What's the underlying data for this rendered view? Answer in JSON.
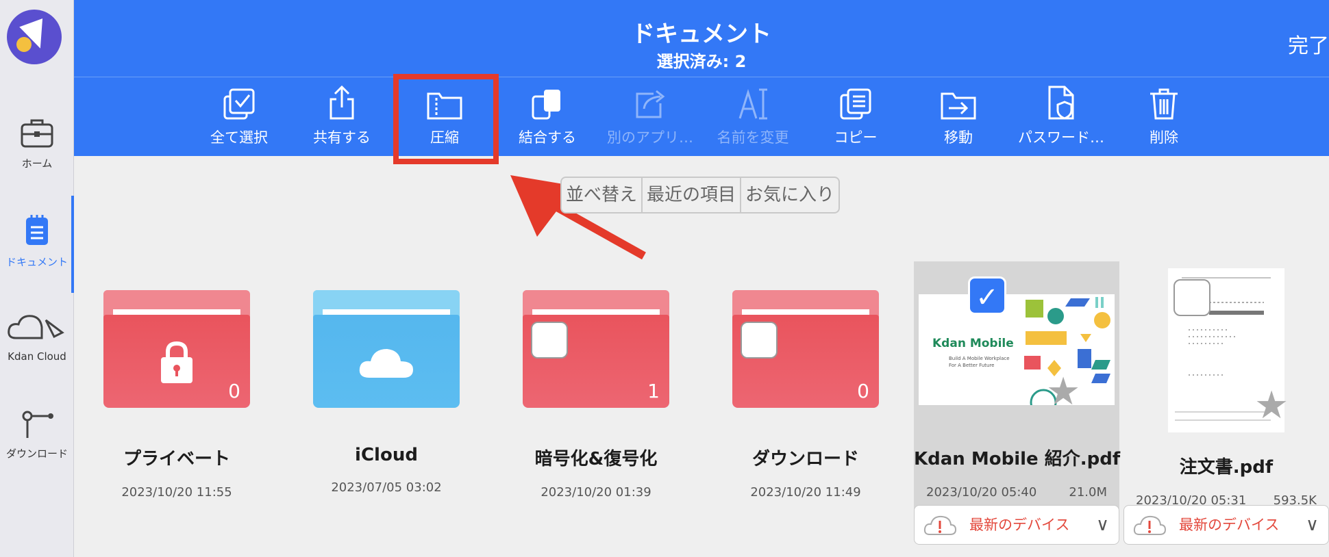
{
  "sidebar": {
    "items": [
      {
        "label": "ホーム",
        "icon": "briefcase-icon"
      },
      {
        "label": "ドキュメント",
        "icon": "document-icon"
      },
      {
        "label": "Kdan Cloud",
        "icon": "cloud-icon"
      },
      {
        "label": "ダウンロード",
        "icon": "download-icon"
      }
    ],
    "active": "ドキュメント"
  },
  "header": {
    "title": "ドキュメント",
    "subtitle": "選択済み: 2",
    "done_label": "完了"
  },
  "toolbar": {
    "items": [
      {
        "label": "全て選択",
        "icon": "select-all-icon",
        "enabled": true
      },
      {
        "label": "共有する",
        "icon": "share-icon",
        "enabled": true
      },
      {
        "label": "圧縮",
        "icon": "compress-icon",
        "enabled": true,
        "highlighted": true
      },
      {
        "label": "結合する",
        "icon": "merge-icon",
        "enabled": true
      },
      {
        "label": "別のアプリ…",
        "icon": "open-in-icon",
        "enabled": false
      },
      {
        "label": "名前を変更",
        "icon": "rename-icon",
        "enabled": false
      },
      {
        "label": "コピー",
        "icon": "copy-icon",
        "enabled": true
      },
      {
        "label": "移動",
        "icon": "move-icon",
        "enabled": true
      },
      {
        "label": "パスワード…",
        "icon": "password-icon",
        "enabled": true
      },
      {
        "label": "削除",
        "icon": "trash-icon",
        "enabled": true
      }
    ]
  },
  "segmented": {
    "options": [
      "並べ替え",
      "最近の項目",
      "お気に入り"
    ]
  },
  "items": [
    {
      "name": "プライベート",
      "date": "2023/10/20 11:55",
      "type": "folder",
      "color": "#e9545d",
      "count": "0"
    },
    {
      "name": "iCloud",
      "date": "2023/07/05 03:02",
      "type": "folder",
      "color": "#55b7ee"
    },
    {
      "name": "暗号化&復号化",
      "date": "2023/10/20 01:39",
      "type": "folder",
      "color": "#e9545d",
      "count": "1"
    },
    {
      "name": "ダウンロード",
      "date": "2023/10/20 11:49",
      "type": "folder",
      "color": "#e9545d",
      "count": "0"
    },
    {
      "name": "Kdan Mobile 紹介.pdf",
      "date": "2023/10/20 05:40",
      "size": "21.0M",
      "type": "pdf",
      "selected": true,
      "device_status": "最新のデバイス",
      "thumb_title": "Kdan Mobile",
      "thumb_sub1": "Build A Mobile Workplace",
      "thumb_sub2": "For A Better Future"
    },
    {
      "name": "注文書.pdf",
      "date": "2023/10/20 05:31",
      "size": "593.5K",
      "type": "pdf",
      "selected": false,
      "device_status": "最新のデバイス"
    }
  ],
  "colors": {
    "accent": "#3378f6",
    "highlight": "#e43a2a",
    "folder_red": "#e9545d",
    "folder_blue": "#55b7ee"
  }
}
